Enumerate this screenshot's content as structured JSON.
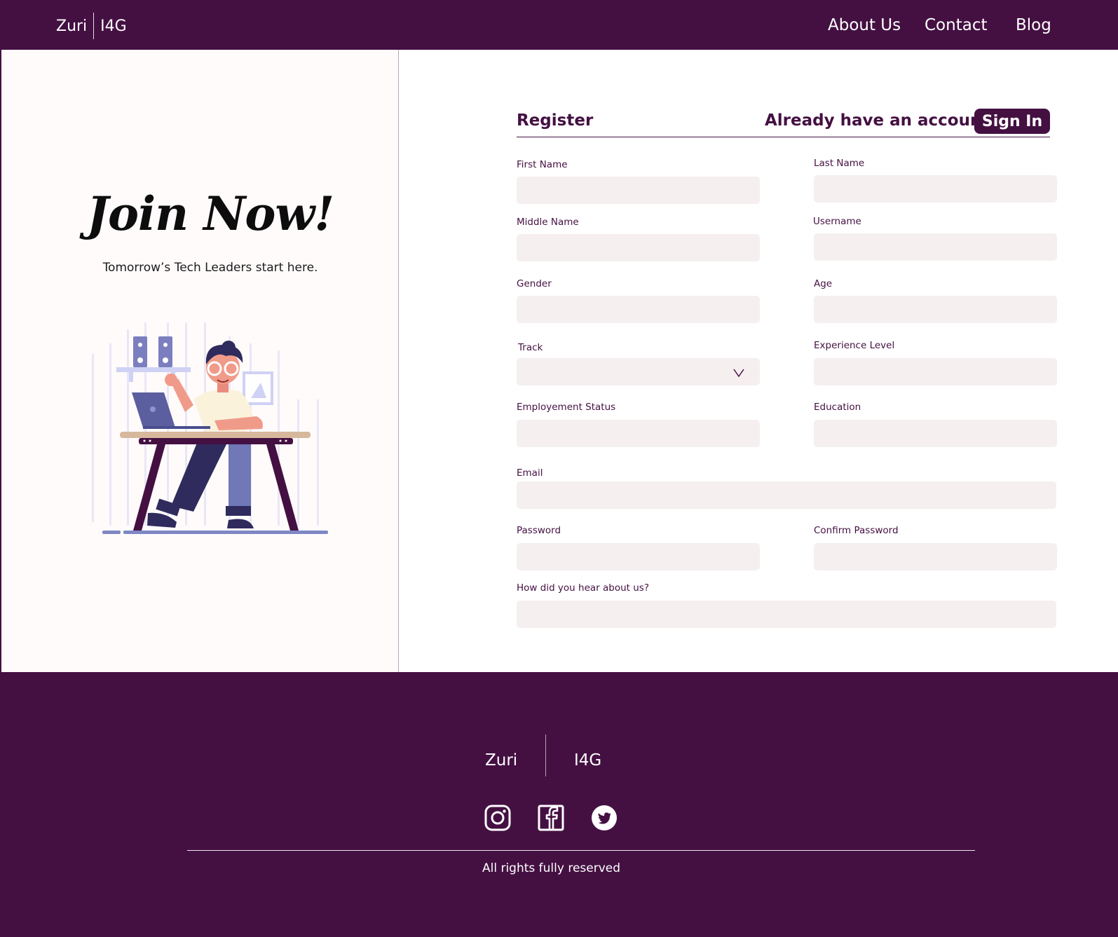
{
  "header": {
    "brand_left": "Zuri",
    "brand_right": "I4G",
    "nav": [
      {
        "label": "About Us"
      },
      {
        "label": "Contact"
      },
      {
        "label": "Blog"
      }
    ]
  },
  "hero": {
    "title": "Join Now!",
    "subtitle": "Tomorrow’s Tech Leaders start here."
  },
  "form": {
    "title": "Register",
    "signin_prompt": "Already have an account?",
    "signin_button": "Sign In",
    "fields": {
      "first_name": {
        "label": "First Name",
        "value": ""
      },
      "last_name": {
        "label": "Last Name",
        "value": ""
      },
      "middle_name": {
        "label": "Middle Name",
        "value": ""
      },
      "username": {
        "label": "Username",
        "value": ""
      },
      "gender": {
        "label": "Gender",
        "value": ""
      },
      "age": {
        "label": "Age",
        "value": ""
      },
      "track": {
        "label": "Track",
        "value": ""
      },
      "experience_level": {
        "label": "Experience Level",
        "value": ""
      },
      "employment_status": {
        "label": "Employement Status",
        "value": ""
      },
      "education": {
        "label": "Education",
        "value": ""
      },
      "email": {
        "label": "Email",
        "value": ""
      },
      "password": {
        "label": "Password",
        "value": ""
      },
      "confirm_password": {
        "label": "Confirm Password",
        "value": ""
      },
      "referral": {
        "label": "How did you hear about us?",
        "value": ""
      }
    }
  },
  "footer": {
    "brand_left": "Zuri",
    "brand_right": "I4G",
    "social": [
      "instagram-icon",
      "facebook-icon",
      "twitter-icon"
    ],
    "rights": "All rights fully reserved"
  },
  "colors": {
    "brand_purple": "#441042",
    "input_bg": "#f5efef",
    "left_panel_bg": "#fffbfb"
  }
}
